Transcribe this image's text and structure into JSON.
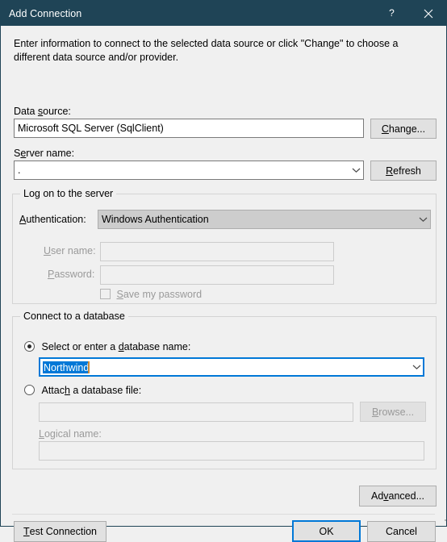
{
  "window": {
    "title": "Add Connection",
    "help_icon": "question-mark-icon",
    "close_icon": "close-icon"
  },
  "intro": "Enter information to connect to the selected data source or click \"Change\" to choose a different data source and/or provider.",
  "data_source": {
    "label_pre": "Data ",
    "label_accel": "s",
    "label_post": "ource:",
    "value": "Microsoft SQL Server (SqlClient)",
    "change_button": {
      "pre": "",
      "accel": "C",
      "post": "hange..."
    }
  },
  "server": {
    "label_pre": "S",
    "label_accel": "e",
    "label_post": "rver name:",
    "value": ".",
    "refresh_button": {
      "pre": "",
      "accel": "R",
      "post": "efresh"
    },
    "dropdown_icon": "chevron-down-icon"
  },
  "logon_group": {
    "title": "Log on to the server",
    "authentication": {
      "label_pre": "",
      "label_accel": "A",
      "label_post": "uthentication:",
      "value": "Windows Authentication",
      "dropdown_icon": "chevron-down-icon"
    },
    "username": {
      "label_pre": "",
      "label_accel": "U",
      "label_post": "ser name:",
      "value": "",
      "enabled": false
    },
    "password": {
      "label_pre": "",
      "label_accel": "P",
      "label_post": "assword:",
      "value": "",
      "enabled": false
    },
    "save_password": {
      "label_pre": "",
      "label_accel": "S",
      "label_post": "ave my password",
      "checked": false,
      "enabled": false
    }
  },
  "database_group": {
    "title": "Connect to a database",
    "select_option": {
      "label_pre": "Select or enter a ",
      "label_accel": "d",
      "label_post": "atabase name:",
      "selected": true,
      "value": "Northwind",
      "value_selected_text": true,
      "dropdown_icon": "chevron-down-icon"
    },
    "attach_option": {
      "label_pre": "Attac",
      "label_accel": "h",
      "label_post": " a database file:",
      "selected": false,
      "file_value": "",
      "browse_button": {
        "pre": "",
        "accel": "B",
        "post": "rowse..."
      },
      "logical_name": {
        "label_pre": "",
        "label_accel": "L",
        "label_post": "ogical name:",
        "value": ""
      }
    }
  },
  "footer": {
    "advanced_button": {
      "pre": "Ad",
      "accel": "v",
      "post": "anced..."
    },
    "test_connection_button": {
      "pre": "",
      "accel": "T",
      "post": "est Connection"
    },
    "ok_button": "OK",
    "cancel_button": "Cancel"
  },
  "colors": {
    "titlebar": "#1f4456",
    "accent": "#0078d7",
    "dialog_bg": "#f0f0f0",
    "selection_bg": "#0078d7",
    "caret": "#c98a3a"
  }
}
